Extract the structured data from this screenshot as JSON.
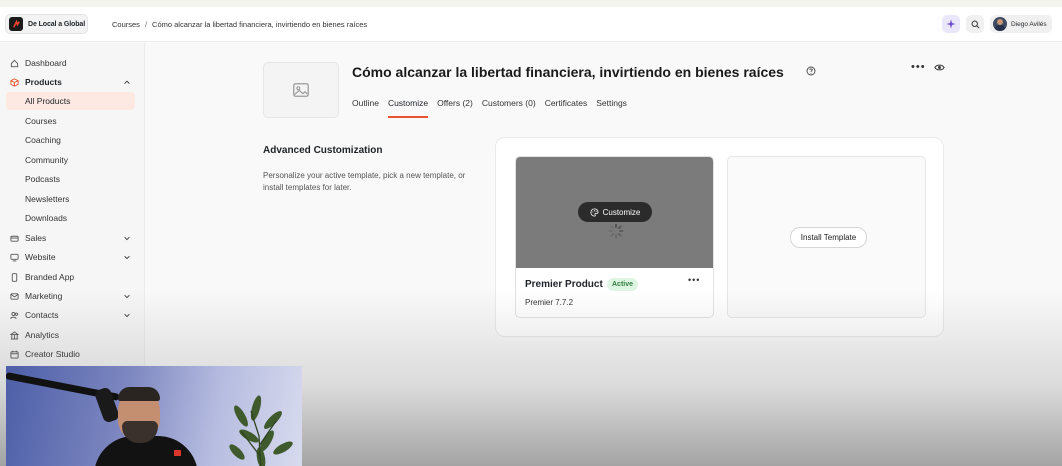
{
  "brand": {
    "name": "De Local a Global"
  },
  "breadcrumb": {
    "parent": "Courses",
    "separator": "/",
    "current": "Cómo alcanzar la libertad financiera, invirtiendo en bienes raíces"
  },
  "user": {
    "name": "Diego Avilés"
  },
  "sidebar": {
    "items": [
      {
        "label": "Dashboard",
        "icon": "home-icon"
      },
      {
        "label": "Products",
        "icon": "box-icon"
      },
      {
        "label": "All Products"
      },
      {
        "label": "Courses"
      },
      {
        "label": "Coaching"
      },
      {
        "label": "Community"
      },
      {
        "label": "Podcasts"
      },
      {
        "label": "Newsletters"
      },
      {
        "label": "Downloads"
      },
      {
        "label": "Sales",
        "icon": "wallet-icon"
      },
      {
        "label": "Website",
        "icon": "monitor-icon"
      },
      {
        "label": "Branded App",
        "icon": "phone-icon"
      },
      {
        "label": "Marketing",
        "icon": "mail-icon"
      },
      {
        "label": "Contacts",
        "icon": "users-icon"
      },
      {
        "label": "Analytics",
        "icon": "building-icon"
      },
      {
        "label": "Creator Studio",
        "icon": "calendar-icon"
      }
    ]
  },
  "course": {
    "title": "Cómo alcanzar la libertad financiera, invirtiendo en bienes raíces",
    "tabs": [
      {
        "label": "Outline"
      },
      {
        "label": "Customize"
      },
      {
        "label": "Offers (2)"
      },
      {
        "label": "Customers (0)"
      },
      {
        "label": "Certificates"
      },
      {
        "label": "Settings"
      }
    ],
    "active_tab": "Customize"
  },
  "customization": {
    "title": "Advanced Customization",
    "description": "Personalize your active template, pick a new template, or install templates for later.",
    "template": {
      "customize_label": "Customize",
      "name": "Premier Product",
      "badge": "Active",
      "version": "Premier 7.7.2"
    },
    "install_label": "Install Template"
  },
  "colors": {
    "accent": "#e8542e",
    "active_bg": "#fde8e2",
    "badge_bg": "#dff5e3",
    "badge_text": "#2f7d3c"
  }
}
